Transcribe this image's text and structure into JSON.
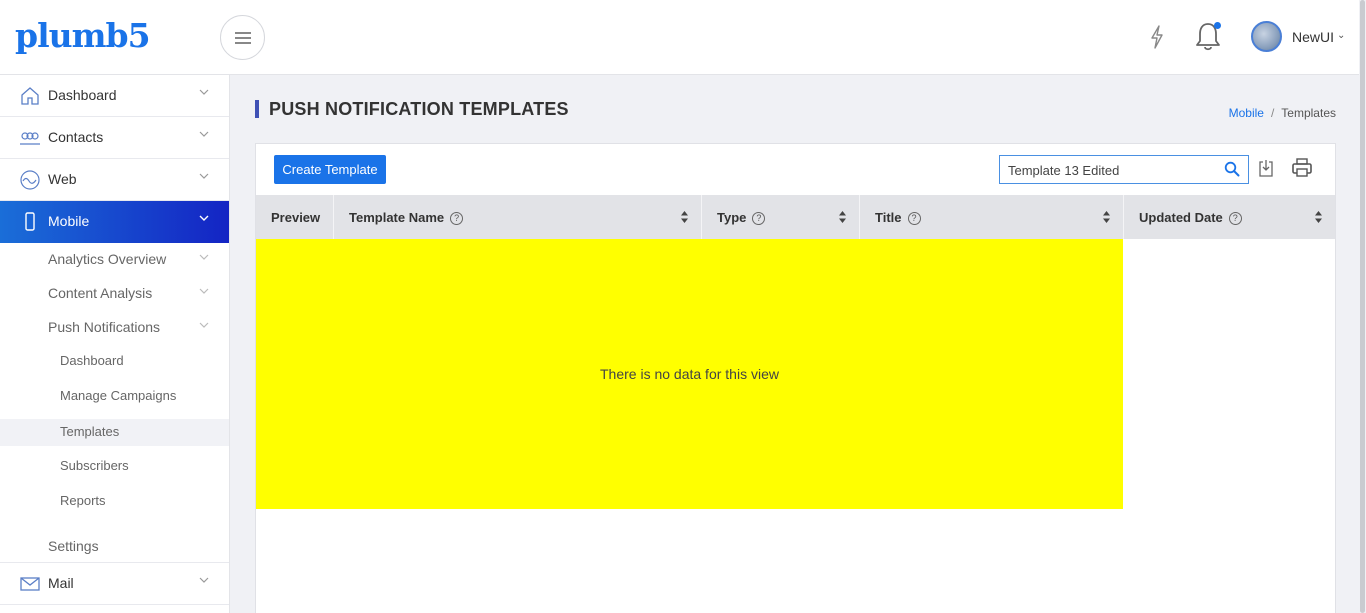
{
  "brand": {
    "logo_text": "plumb5",
    "color": "#1a73e8"
  },
  "header": {
    "user_name": "NewUI",
    "icons": [
      "hamburger-menu-icon",
      "lightning-icon",
      "bell-icon",
      "globe-avatar-icon"
    ]
  },
  "sidebar": {
    "items": [
      {
        "label": "Dashboard",
        "icon": "home-icon"
      },
      {
        "label": "Contacts",
        "icon": "people-icon"
      },
      {
        "label": "Web",
        "icon": "wave-icon"
      },
      {
        "label": "Mobile",
        "icon": "phone-icon",
        "active": true
      },
      {
        "label": "Mail",
        "icon": "mail-icon"
      }
    ],
    "mobile_sub": {
      "analytics_overview": "Analytics Overview",
      "content_analysis": "Content Analysis",
      "push_notifications": "Push Notifications",
      "push_children": [
        "Dashboard",
        "Manage Campaigns",
        "Templates",
        "Subscribers",
        "Reports"
      ],
      "selected": "Templates",
      "settings": "Settings"
    },
    "active_color": "#1a6ed8"
  },
  "page": {
    "title": "PUSH NOTIFICATION TEMPLATES",
    "breadcrumb": {
      "parent": "Mobile",
      "separator": "/",
      "current": "Templates"
    }
  },
  "toolbar": {
    "create_label": "Create Template",
    "search_value": "Template 13 Edited"
  },
  "table": {
    "columns": [
      {
        "label": "Preview",
        "help": false,
        "sortable": false
      },
      {
        "label": "Template Name",
        "help": true,
        "sortable": true
      },
      {
        "label": "Type",
        "help": true,
        "sortable": true
      },
      {
        "label": "Title",
        "help": true,
        "sortable": true
      },
      {
        "label": "Updated Date",
        "help": true,
        "sortable": true
      }
    ],
    "empty_message": "There is no data for this view",
    "empty_highlight": "#ffff00"
  }
}
